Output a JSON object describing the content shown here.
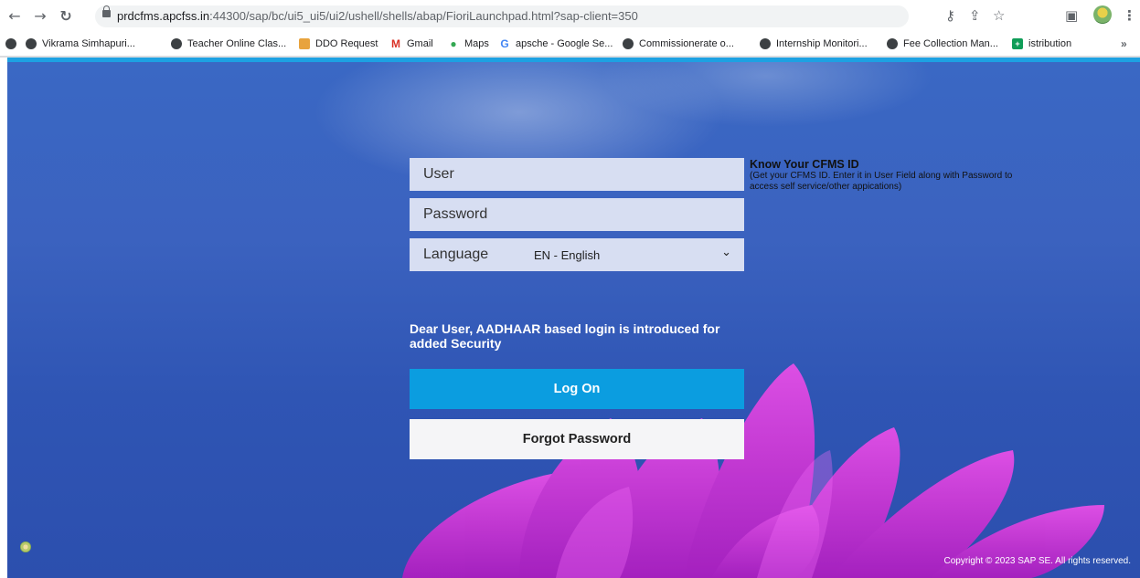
{
  "browser": {
    "url_host": "prdcfms.apcfss.in",
    "url_rest": ":44300/sap/bc/ui5_ui5/ui2/ushell/shells/abap/FioriLaunchpad.html?sap-client=350",
    "icons": {
      "back": "←",
      "forward": "→",
      "reload": "↻",
      "key": "⚷",
      "share": "⇪",
      "star": "☆",
      "sidepanel": "▣",
      "menu": "⋮"
    },
    "bookmarks": [
      {
        "label": "",
        "icon": "globe"
      },
      {
        "label": "Vikrama Simhapuri...",
        "icon": "globe"
      },
      {
        "label": "Teacher Online Clas...",
        "icon": "globe"
      },
      {
        "label": "DDO Request",
        "icon": "ddo"
      },
      {
        "label": "Gmail",
        "icon": "gmail"
      },
      {
        "label": "Maps",
        "icon": "maps"
      },
      {
        "label": "apsche - Google Se...",
        "icon": "google"
      },
      {
        "label": "Commissionerate o...",
        "icon": "globe"
      },
      {
        "label": "Internship Monitori...",
        "icon": "globe"
      },
      {
        "label": "Fee Collection Man...",
        "icon": "globe"
      },
      {
        "label": "istribution",
        "icon": "sheet"
      }
    ],
    "more": "»"
  },
  "login": {
    "user_placeholder": "User",
    "password_placeholder": "Password",
    "language_label": "Language",
    "language_value": "EN - English",
    "know_title": "Know Your CFMS ID",
    "know_desc": "(Get your CFMS ID. Enter it in User Field along with Password to access self service/other appications)",
    "notice": "Dear User, AADHAAR based login is introduced for added Security",
    "logon_label": "Log On",
    "forgot_label": "Forgot Password"
  },
  "footer": {
    "copyright": "Copyright © 2023 SAP SE. All rights reserved."
  },
  "colors": {
    "background": "#3a64c0",
    "accent_line": "#1da1e2",
    "logon_button": "#0b9de0",
    "field_background": "#d7def2",
    "flower": "#c43fd6"
  }
}
